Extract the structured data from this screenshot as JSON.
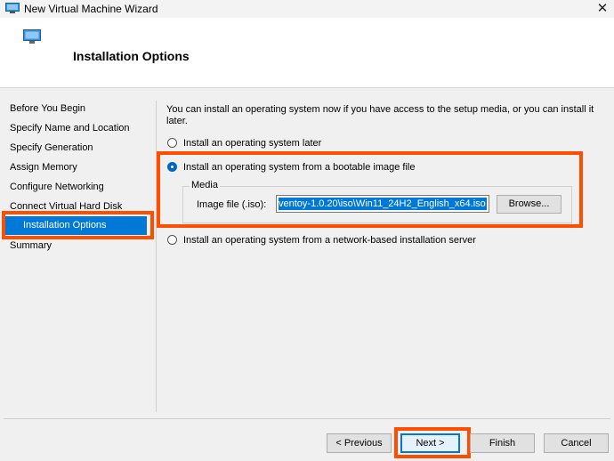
{
  "window": {
    "title": "New Virtual Machine Wizard"
  },
  "header": {
    "title": "Installation Options"
  },
  "nav": {
    "items": [
      "Before You Begin",
      "Specify Name and Location",
      "Specify Generation",
      "Assign Memory",
      "Configure Networking",
      "Connect Virtual Hard Disk",
      "Installation Options",
      "Summary"
    ],
    "selected_index": 6
  },
  "content": {
    "intro": "You can install an operating system now if you have access to the setup media, or you can install it later.",
    "options": [
      {
        "label": "Install an operating system later",
        "checked": false
      },
      {
        "label": "Install an operating system from a bootable image file",
        "checked": true
      },
      {
        "label": "Install an operating system from a network-based installation server",
        "checked": false
      }
    ],
    "media": {
      "group_label": "Media",
      "image_label": "Image file (.iso):",
      "image_value": "ventoy-1.0.20\\iso\\Win11_24H2_English_x64.iso",
      "browse_label": "Browse..."
    }
  },
  "footer": {
    "previous": "< Previous",
    "next": "Next >",
    "finish": "Finish",
    "cancel": "Cancel"
  },
  "colors": {
    "accent": "#0078d7",
    "highlight": "#ff4e00"
  }
}
